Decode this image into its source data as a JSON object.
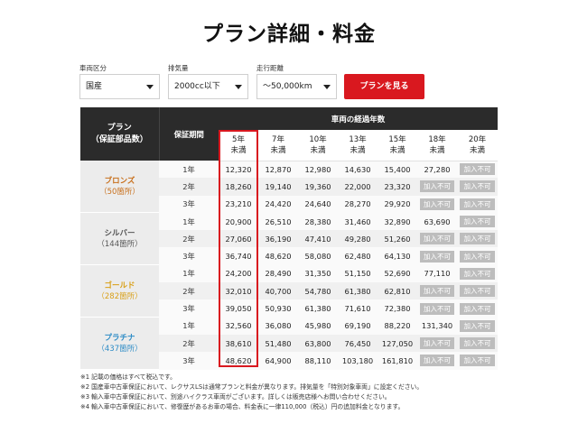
{
  "title": "プラン詳細・料金",
  "filters": [
    {
      "label": "車両区分",
      "value": "国産"
    },
    {
      "label": "排気量",
      "value": "2000cc以下"
    },
    {
      "label": "走行距離",
      "value": "〜50,000km"
    }
  ],
  "search_button": "プランを見る",
  "table": {
    "plan_header": [
      "プラン",
      "（保証部品数）"
    ],
    "warranty_header": "保証期間",
    "years_header": "車両の経過年数",
    "years": [
      [
        "5年",
        "未満"
      ],
      [
        "7年",
        "未満"
      ],
      [
        "10年",
        "未満"
      ],
      [
        "13年",
        "未満"
      ],
      [
        "15年",
        "未満"
      ],
      [
        "18年",
        "未満"
      ],
      [
        "20年",
        "未満"
      ]
    ],
    "plans": [
      {
        "name": "ブロンズ",
        "parts": "（50箇所）",
        "color": "#c8701d",
        "rows": [
          {
            "term": "1年",
            "values": [
              "12,320",
              "12,870",
              "12,980",
              "14,630",
              "15,400",
              "27,280",
              "加入不可"
            ]
          },
          {
            "term": "2年",
            "values": [
              "18,260",
              "19,140",
              "19,360",
              "22,000",
              "23,320",
              "加入不可",
              "加入不可"
            ]
          },
          {
            "term": "3年",
            "values": [
              "23,210",
              "24,420",
              "24,640",
              "28,270",
              "29,920",
              "加入不可",
              "加入不可"
            ]
          }
        ]
      },
      {
        "name": "シルバー",
        "parts": "（144箇所）",
        "color": "#555555",
        "rows": [
          {
            "term": "1年",
            "values": [
              "20,900",
              "26,510",
              "28,380",
              "31,460",
              "32,890",
              "63,690",
              "加入不可"
            ]
          },
          {
            "term": "2年",
            "values": [
              "27,060",
              "36,190",
              "47,410",
              "49,280",
              "51,260",
              "加入不可",
              "加入不可"
            ]
          },
          {
            "term": "3年",
            "values": [
              "36,740",
              "48,620",
              "58,080",
              "62,480",
              "64,130",
              "加入不可",
              "加入不可"
            ]
          }
        ]
      },
      {
        "name": "ゴールド",
        "parts": "（282箇所）",
        "color": "#d9a018",
        "rows": [
          {
            "term": "1年",
            "values": [
              "24,200",
              "28,490",
              "31,350",
              "51,150",
              "52,690",
              "77,110",
              "加入不可"
            ]
          },
          {
            "term": "2年",
            "values": [
              "32,010",
              "40,700",
              "54,780",
              "61,380",
              "62,810",
              "加入不可",
              "加入不可"
            ]
          },
          {
            "term": "3年",
            "values": [
              "39,050",
              "50,930",
              "61,380",
              "71,610",
              "72,380",
              "加入不可",
              "加入不可"
            ]
          }
        ]
      },
      {
        "name": "プラチナ",
        "parts": "（437箇所）",
        "color": "#2e8cc6",
        "rows": [
          {
            "term": "1年",
            "values": [
              "32,560",
              "36,080",
              "45,980",
              "69,190",
              "88,220",
              "131,340",
              "加入不可"
            ]
          },
          {
            "term": "2年",
            "values": [
              "38,610",
              "51,480",
              "63,800",
              "76,450",
              "127,050",
              "加入不可",
              "加入不可"
            ]
          },
          {
            "term": "3年",
            "values": [
              "48,620",
              "64,900",
              "88,110",
              "103,180",
              "161,810",
              "加入不可",
              "加入不可"
            ]
          }
        ]
      }
    ]
  },
  "notes": [
    "※1 記載の価格はすべて税込です。",
    "※2 国産車中古車保証において、レクサスLSは通常プランと料金が異なります。排気量を「特別対象車両」に設定ください。",
    "※3 輸入車中古車保証において、別途ハイクラス車両がございます。詳しくは販売店様へお問い合わせください。",
    "※4 輸入車中古車保証において、修復歴があるお車の場合、料金表に一律110,000（税込）円の追加料金となります。"
  ],
  "accent_color": "#d9181f",
  "header_bg": "#2b2b2b"
}
